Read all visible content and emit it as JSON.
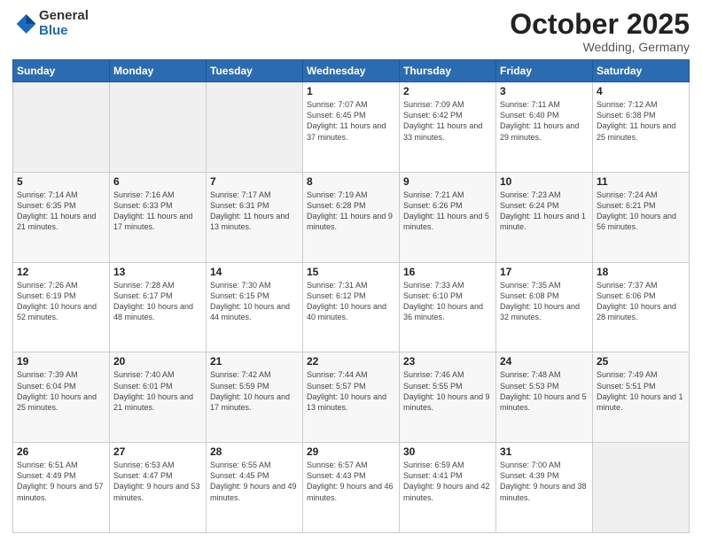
{
  "header": {
    "logo_general": "General",
    "logo_blue": "Blue",
    "month_title": "October 2025",
    "subtitle": "Wedding, Germany"
  },
  "days_of_week": [
    "Sunday",
    "Monday",
    "Tuesday",
    "Wednesday",
    "Thursday",
    "Friday",
    "Saturday"
  ],
  "weeks": [
    [
      {
        "day": "",
        "info": ""
      },
      {
        "day": "",
        "info": ""
      },
      {
        "day": "",
        "info": ""
      },
      {
        "day": "1",
        "info": "Sunrise: 7:07 AM\nSunset: 6:45 PM\nDaylight: 11 hours\nand 37 minutes."
      },
      {
        "day": "2",
        "info": "Sunrise: 7:09 AM\nSunset: 6:42 PM\nDaylight: 11 hours\nand 33 minutes."
      },
      {
        "day": "3",
        "info": "Sunrise: 7:11 AM\nSunset: 6:40 PM\nDaylight: 11 hours\nand 29 minutes."
      },
      {
        "day": "4",
        "info": "Sunrise: 7:12 AM\nSunset: 6:38 PM\nDaylight: 11 hours\nand 25 minutes."
      }
    ],
    [
      {
        "day": "5",
        "info": "Sunrise: 7:14 AM\nSunset: 6:35 PM\nDaylight: 11 hours\nand 21 minutes."
      },
      {
        "day": "6",
        "info": "Sunrise: 7:16 AM\nSunset: 6:33 PM\nDaylight: 11 hours\nand 17 minutes."
      },
      {
        "day": "7",
        "info": "Sunrise: 7:17 AM\nSunset: 6:31 PM\nDaylight: 11 hours\nand 13 minutes."
      },
      {
        "day": "8",
        "info": "Sunrise: 7:19 AM\nSunset: 6:28 PM\nDaylight: 11 hours\nand 9 minutes."
      },
      {
        "day": "9",
        "info": "Sunrise: 7:21 AM\nSunset: 6:26 PM\nDaylight: 11 hours\nand 5 minutes."
      },
      {
        "day": "10",
        "info": "Sunrise: 7:23 AM\nSunset: 6:24 PM\nDaylight: 11 hours\nand 1 minute."
      },
      {
        "day": "11",
        "info": "Sunrise: 7:24 AM\nSunset: 6:21 PM\nDaylight: 10 hours\nand 56 minutes."
      }
    ],
    [
      {
        "day": "12",
        "info": "Sunrise: 7:26 AM\nSunset: 6:19 PM\nDaylight: 10 hours\nand 52 minutes."
      },
      {
        "day": "13",
        "info": "Sunrise: 7:28 AM\nSunset: 6:17 PM\nDaylight: 10 hours\nand 48 minutes."
      },
      {
        "day": "14",
        "info": "Sunrise: 7:30 AM\nSunset: 6:15 PM\nDaylight: 10 hours\nand 44 minutes."
      },
      {
        "day": "15",
        "info": "Sunrise: 7:31 AM\nSunset: 6:12 PM\nDaylight: 10 hours\nand 40 minutes."
      },
      {
        "day": "16",
        "info": "Sunrise: 7:33 AM\nSunset: 6:10 PM\nDaylight: 10 hours\nand 36 minutes."
      },
      {
        "day": "17",
        "info": "Sunrise: 7:35 AM\nSunset: 6:08 PM\nDaylight: 10 hours\nand 32 minutes."
      },
      {
        "day": "18",
        "info": "Sunrise: 7:37 AM\nSunset: 6:06 PM\nDaylight: 10 hours\nand 28 minutes."
      }
    ],
    [
      {
        "day": "19",
        "info": "Sunrise: 7:39 AM\nSunset: 6:04 PM\nDaylight: 10 hours\nand 25 minutes."
      },
      {
        "day": "20",
        "info": "Sunrise: 7:40 AM\nSunset: 6:01 PM\nDaylight: 10 hours\nand 21 minutes."
      },
      {
        "day": "21",
        "info": "Sunrise: 7:42 AM\nSunset: 5:59 PM\nDaylight: 10 hours\nand 17 minutes."
      },
      {
        "day": "22",
        "info": "Sunrise: 7:44 AM\nSunset: 5:57 PM\nDaylight: 10 hours\nand 13 minutes."
      },
      {
        "day": "23",
        "info": "Sunrise: 7:46 AM\nSunset: 5:55 PM\nDaylight: 10 hours\nand 9 minutes."
      },
      {
        "day": "24",
        "info": "Sunrise: 7:48 AM\nSunset: 5:53 PM\nDaylight: 10 hours\nand 5 minutes."
      },
      {
        "day": "25",
        "info": "Sunrise: 7:49 AM\nSunset: 5:51 PM\nDaylight: 10 hours\nand 1 minute."
      }
    ],
    [
      {
        "day": "26",
        "info": "Sunrise: 6:51 AM\nSunset: 4:49 PM\nDaylight: 9 hours\nand 57 minutes."
      },
      {
        "day": "27",
        "info": "Sunrise: 6:53 AM\nSunset: 4:47 PM\nDaylight: 9 hours\nand 53 minutes."
      },
      {
        "day": "28",
        "info": "Sunrise: 6:55 AM\nSunset: 4:45 PM\nDaylight: 9 hours\nand 49 minutes."
      },
      {
        "day": "29",
        "info": "Sunrise: 6:57 AM\nSunset: 4:43 PM\nDaylight: 9 hours\nand 46 minutes."
      },
      {
        "day": "30",
        "info": "Sunrise: 6:59 AM\nSunset: 4:41 PM\nDaylight: 9 hours\nand 42 minutes."
      },
      {
        "day": "31",
        "info": "Sunrise: 7:00 AM\nSunset: 4:39 PM\nDaylight: 9 hours\nand 38 minutes."
      },
      {
        "day": "",
        "info": ""
      }
    ]
  ]
}
